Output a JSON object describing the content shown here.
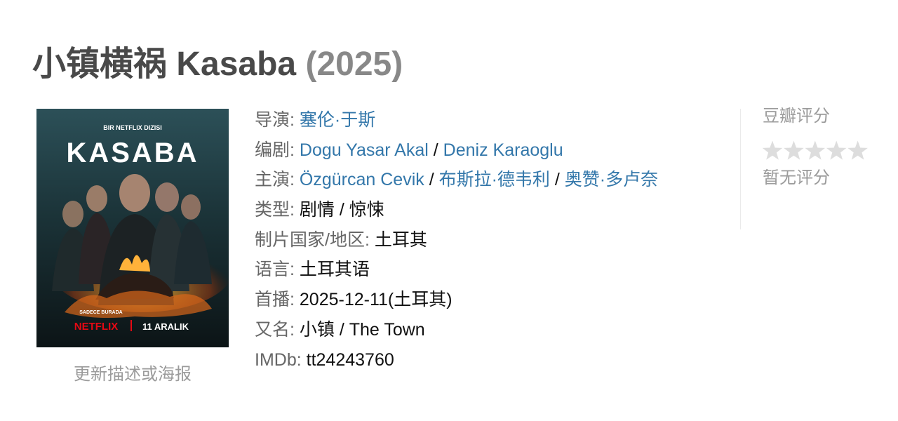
{
  "title": {
    "main": "小镇横祸 Kasaba",
    "year": "(2025)"
  },
  "poster": {
    "alt": "Kasaba poster",
    "tagline": "BIR NETFLIX DIZISI",
    "show_title": "KASABA",
    "sub_text": "SADECE BURADA",
    "brand": "NETFLIX",
    "date": "11 ARALIK"
  },
  "update_link": "更新描述或海报",
  "info": {
    "director": {
      "label": "导演:",
      "names": [
        "塞伦·于斯"
      ]
    },
    "writer": {
      "label": "编剧:",
      "names": [
        "Dogu Yasar Akal",
        "Deniz Karaoglu"
      ]
    },
    "cast": {
      "label": "主演:",
      "names": [
        "Özgürcan Cevik",
        "布斯拉·德韦利",
        "奥赞·多卢奈"
      ]
    },
    "separator": " / ",
    "genre": {
      "label": "类型:",
      "value": "剧情 / 惊悚"
    },
    "country": {
      "label": "制片国家/地区:",
      "value": "土耳其"
    },
    "language": {
      "label": "语言:",
      "value": "土耳其语"
    },
    "premiere": {
      "label": "首播:",
      "value": "2025-12-11(土耳其)"
    },
    "aka": {
      "label": "又名:",
      "value": "小镇 / The Town"
    },
    "imdb": {
      "label": "IMDb:",
      "value": "tt24243760"
    }
  },
  "rating": {
    "heading": "豆瓣评分",
    "stars_filled": 0,
    "stars_total": 5,
    "no_rating": "暂无评分",
    "star_color": "#dddddd"
  },
  "colors": {
    "link": "#3377aa",
    "label": "#666666",
    "title": "#494949",
    "muted": "#9b9b9b"
  }
}
